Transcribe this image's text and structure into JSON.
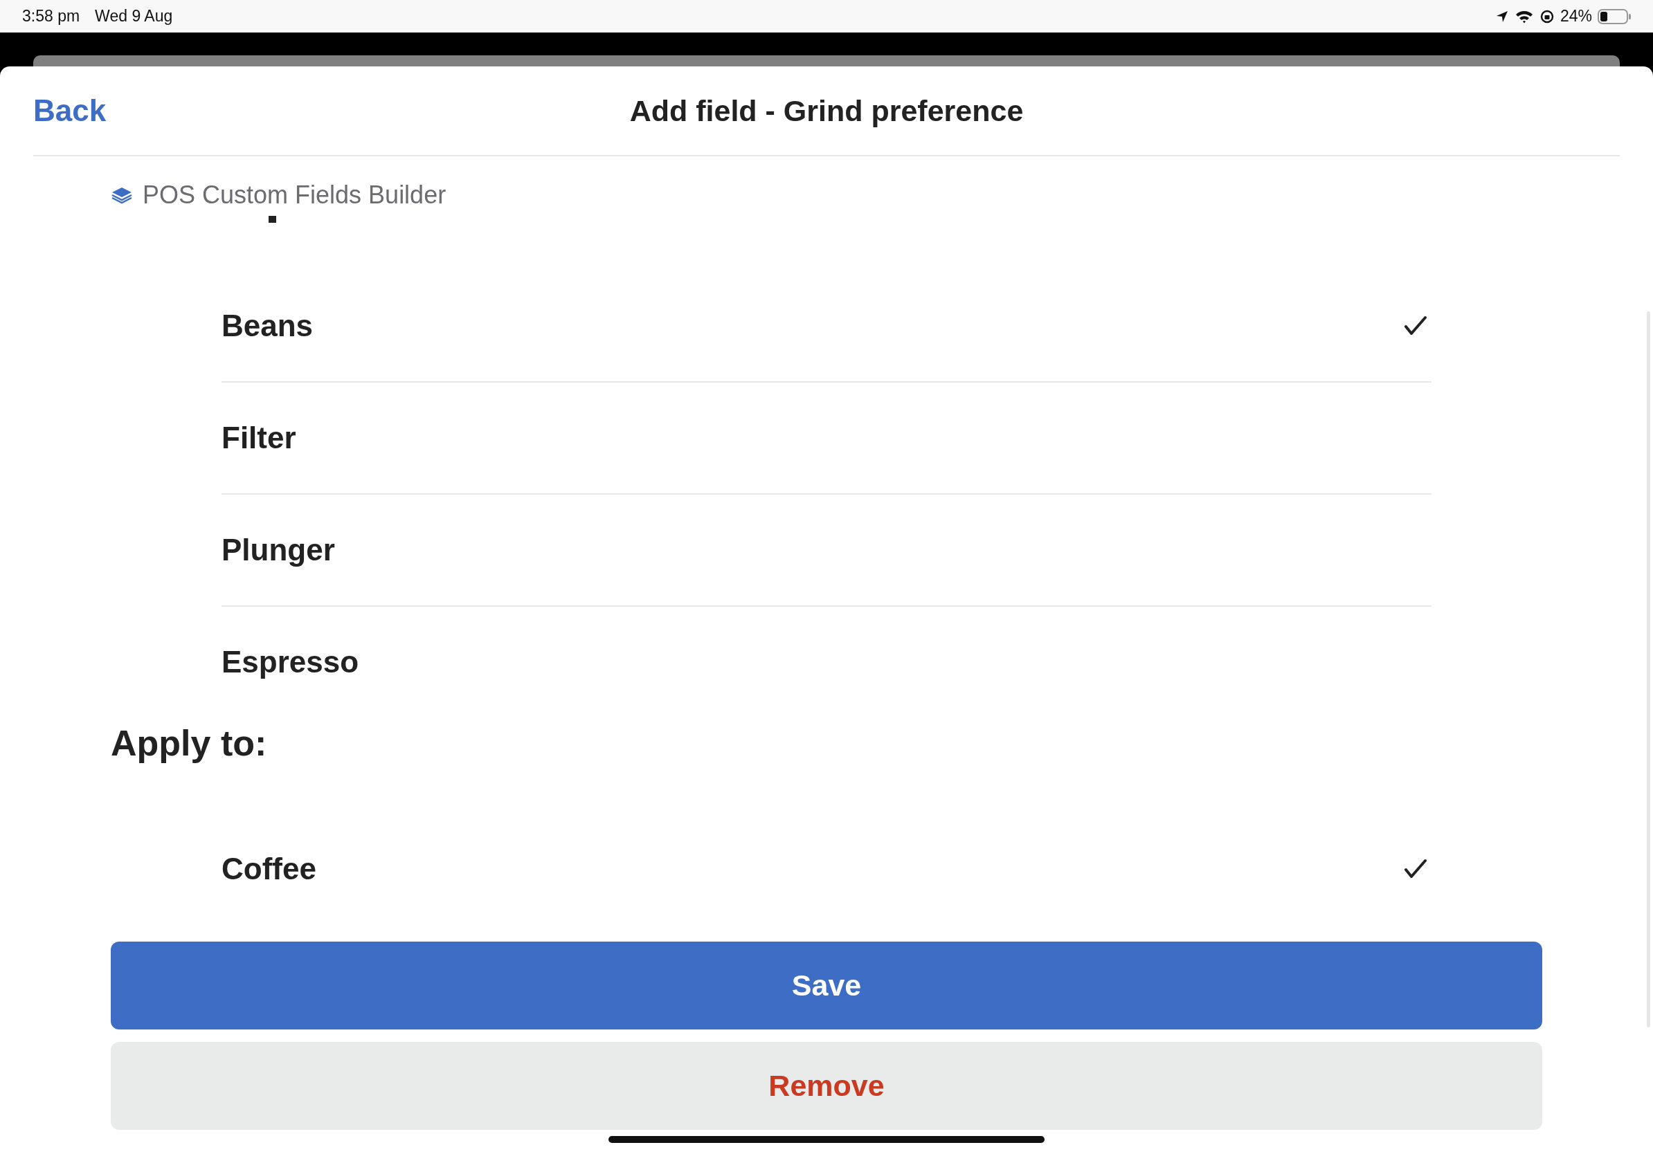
{
  "status_bar": {
    "time": "3:58 pm",
    "date": "Wed 9 Aug",
    "battery": "24%"
  },
  "header": {
    "back": "Back",
    "title": "Add field - Grind preference"
  },
  "brand": {
    "name": "POS Custom Fields Builder"
  },
  "options": [
    {
      "label": "Beans",
      "selected": true
    },
    {
      "label": "Filter",
      "selected": false
    },
    {
      "label": "Plunger",
      "selected": false
    },
    {
      "label": "Espresso",
      "selected": false
    }
  ],
  "apply_to": {
    "heading": "Apply to:",
    "items": [
      {
        "label": "Coffee",
        "selected": true
      }
    ]
  },
  "buttons": [
    {
      "label": "Save",
      "kind": "primary"
    },
    {
      "label": "Remove",
      "kind": "destructive"
    }
  ]
}
